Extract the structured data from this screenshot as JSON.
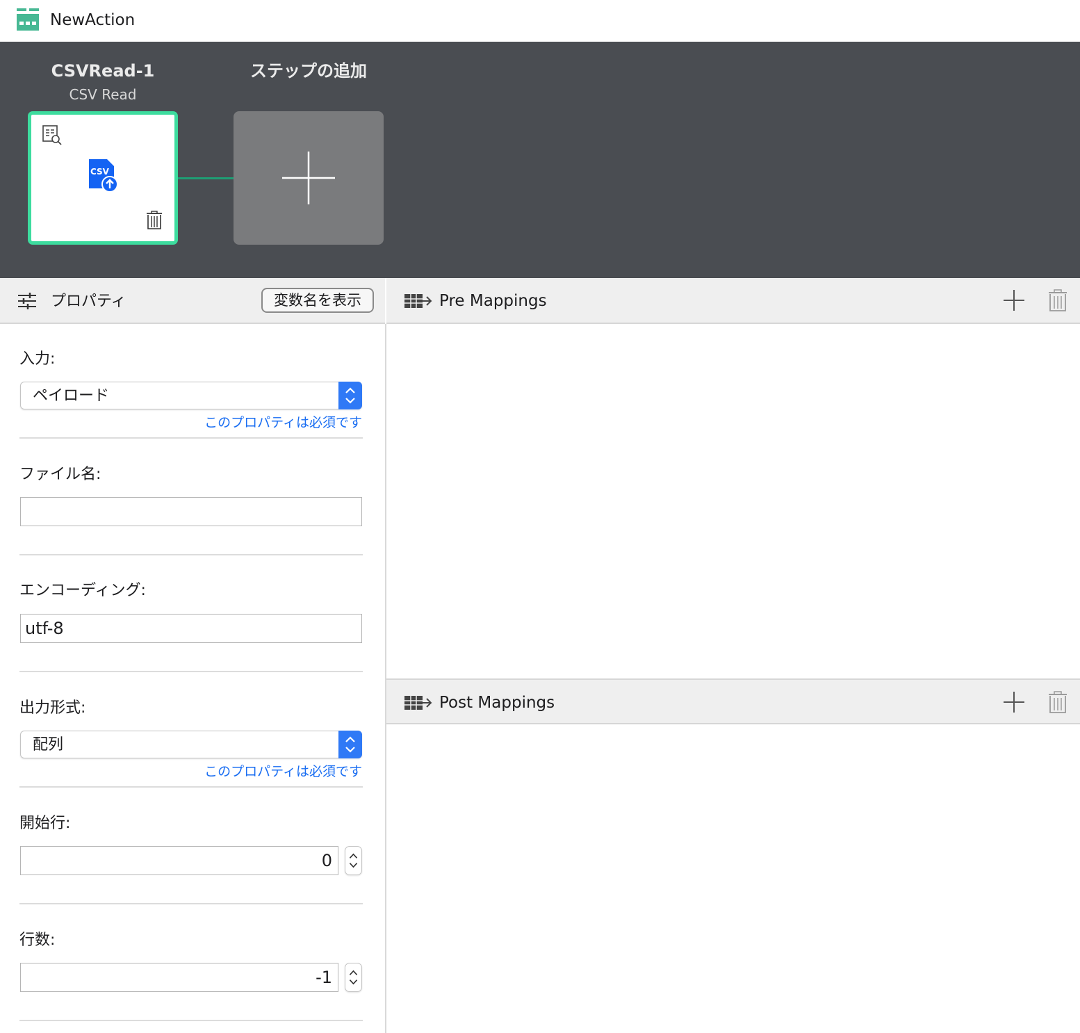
{
  "window": {
    "title": "NewAction"
  },
  "canvas": {
    "step": {
      "name": "CSVRead-1",
      "type": "CSV Read",
      "icon_label": "CSV"
    },
    "add_step": {
      "label": "ステップの追加"
    },
    "colors": {
      "selected_border": "#3ddc9e",
      "connector": "#1e9e74",
      "background": "#4a4d52"
    }
  },
  "properties": {
    "title": "プロパティ",
    "show_var_names_label": "変数名を表示",
    "fields": {
      "input": {
        "label": "入力:",
        "value": "ペイロード",
        "note": "このプロパティは必須です"
      },
      "filename": {
        "label": "ファイル名:",
        "value": ""
      },
      "encoding": {
        "label": "エンコーディング:",
        "value": "utf-8"
      },
      "output_format": {
        "label": "出力形式:",
        "value": "配列",
        "note": "このプロパティは必須です"
      },
      "start_row": {
        "label": "開始行:",
        "value": "0"
      },
      "row_count": {
        "label": "行数:",
        "value": "-1"
      }
    }
  },
  "pre_mappings": {
    "title": "Pre Mappings"
  },
  "post_mappings": {
    "title": "Post Mappings"
  },
  "accent_color": "#2f79f6",
  "link_color": "#1a6ef2"
}
